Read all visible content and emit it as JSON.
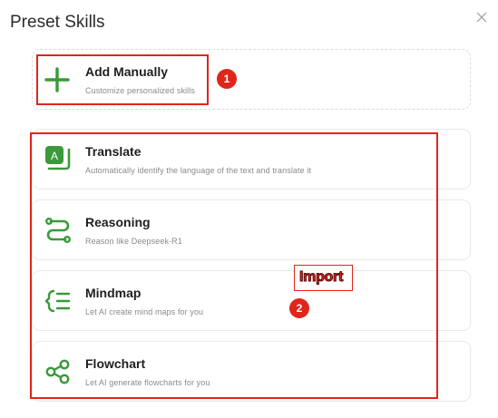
{
  "dialog": {
    "title": "Preset Skills"
  },
  "add": {
    "name": "Add Manually",
    "desc": "Customize personalized skills"
  },
  "skills": [
    {
      "name": "Translate",
      "desc": "Automatically identify the language of the text and translate it",
      "icon": "translate-icon"
    },
    {
      "name": "Reasoning",
      "desc": "Reason like Deepseek-R1",
      "icon": "reasoning-icon"
    },
    {
      "name": "Mindmap",
      "desc": "Let AI create mind maps for you",
      "icon": "mindmap-icon"
    },
    {
      "name": "Flowchart",
      "desc": "Let AI generate flowcharts for you",
      "icon": "flowchart-icon"
    }
  ],
  "annotations": {
    "marker1": "1",
    "marker2": "2",
    "import_label": "Import"
  },
  "colors": {
    "accent": "#3a9a3a",
    "highlight": "#e0251b"
  }
}
